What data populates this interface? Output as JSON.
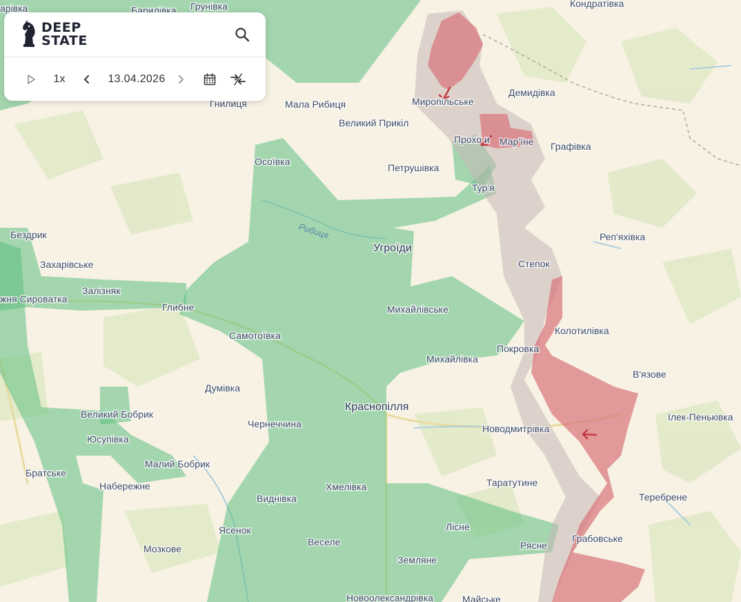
{
  "app": {
    "brand_line1": "DEEP",
    "brand_line2": "STATE"
  },
  "toolbar": {
    "speed": "1x",
    "date": "13.04.2026"
  },
  "icons": {
    "logo": "chess-knight-icon",
    "search": "search-icon",
    "play": "play-icon",
    "prev": "chevron-left-icon",
    "next": "chevron-right-icon",
    "calendar": "calendar-icon",
    "compare": "compare-arrows-icon"
  },
  "colors": {
    "base": "#f7f2e3",
    "ukraine_controlled": "#5fbf84",
    "russia_occupied": "#d9747a",
    "contested": "#c9b8b8"
  },
  "places": {
    "karyivka": "арівка",
    "barylivka": "Барилівка",
    "hrunivka": "Грунівка",
    "kondrativka": "Кондратівка",
    "myropilske": "Миропільське",
    "demydivka": "Демидівка",
    "hnylytsia": "Гнилиця",
    "mala_rybytsia": "Мала Рибиця",
    "velykyi_prykil": "Великий Прикіл",
    "prokhody": "Прохо и",
    "marine": "Мар'їне",
    "hrafivka": "Графівка",
    "osoivka": "Осоївка",
    "petrushivka": "Петрушівка",
    "turia": "Тур'я",
    "repiakhivka": "Реп'яхівка",
    "bezdryk": "Бездрик",
    "uhroidy": "Угроїди",
    "zakharivske": "Захарівське",
    "stepok": "Степок",
    "syrovatka": "жня Сироватка",
    "zalizniak": "Залізняк",
    "hlybne": "Глибне",
    "mykhailivske": "Михайлівське",
    "kolotylivka": "Колотилівка",
    "samotoivka": "Самотоївка",
    "pokrovka": "Покровка",
    "mykhailivka": "Михайлівка",
    "viazove": "В'язове",
    "dumivka": "Думівка",
    "krasnopillia": "Краснопілля",
    "velykyi_bobryk": "Великий Бобрик",
    "ilek_penkivka": "Ілек-Пеньківка",
    "chernechchyna": "Чернеччина",
    "yusupivka": "Юсупівка",
    "novodmytrivka": "Новодмитрівка",
    "malyi_bobryk": "Малий Бобрик",
    "bratske": "Братське",
    "naberezhne": "Набережне",
    "taratutyne": "Таратутине",
    "vydnivka": "Виднівка",
    "khmelivka": "Хмелівка",
    "terebrene": "Теребрене",
    "lisne": "Лісне",
    "yasenok": "Ясенок",
    "riasne": "Рясне",
    "hrabovske": "Грабовське",
    "vesele": "Веселе",
    "mozkove": "Мозкове",
    "zemliane": "Земляне",
    "novooleksandrivka": "Новоолександрівка",
    "maiske": "Майське"
  },
  "rivers": {
    "rybytsia": "Рибиця"
  }
}
